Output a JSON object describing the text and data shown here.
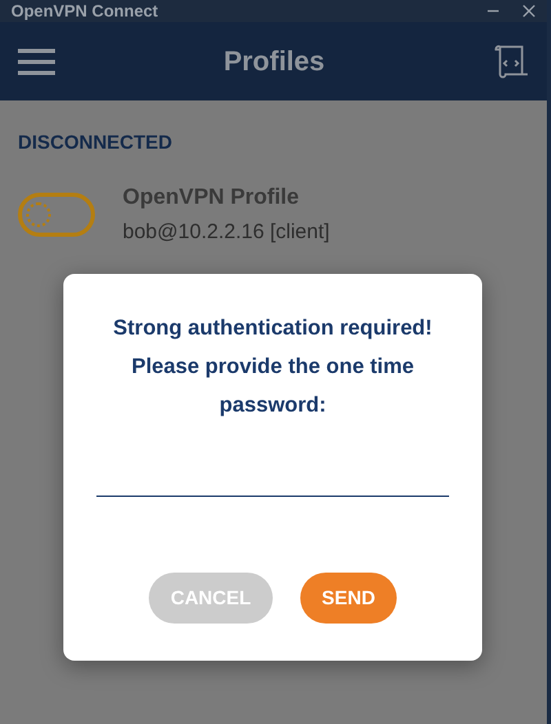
{
  "window": {
    "title": "OpenVPN Connect"
  },
  "header": {
    "title": "Profiles"
  },
  "status": "DISCONNECTED",
  "profile": {
    "name": "OpenVPN Profile",
    "detail": "bob@10.2.2.16 [client]",
    "on": false
  },
  "dialog": {
    "message": "Strong authentication required! Please provide the one time password:",
    "buttons": [
      {
        "label": "CANCEL",
        "kind": "cancel"
      },
      {
        "label": "SEND",
        "kind": "primary"
      }
    ]
  }
}
